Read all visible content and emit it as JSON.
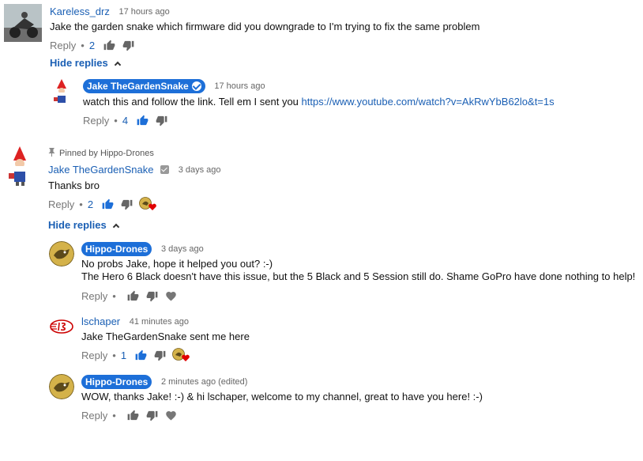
{
  "comments": {
    "c1": {
      "author": "Kareless_drz",
      "time": "17 hours ago",
      "text": "Jake the garden snake which firmware did you downgrade to I'm trying to fix the same problem",
      "reply_label": "Reply",
      "likes": "2"
    },
    "c1_hide": "Hide replies",
    "c2": {
      "author": "Jake TheGardenSnake",
      "time": "17 hours ago",
      "text": "watch this and follow the link. Tell em I sent you ",
      "link": "https://www.youtube.com/watch?v=AkRwYbB62lo&t=1s",
      "reply_label": "Reply",
      "likes": "4"
    },
    "c3": {
      "pinned": "Pinned by Hippo-Drones",
      "author": "Jake TheGardenSnake",
      "time": "3 days ago",
      "text": "Thanks bro",
      "reply_label": "Reply",
      "likes": "2"
    },
    "c3_hide": "Hide replies",
    "c4": {
      "author": "Hippo-Drones",
      "time": "3 days ago",
      "line1": "No probs Jake, hope it helped you out? :-)",
      "line2": "The Hero 6 Black doesn't have this issue, but the 5 Black and 5 Session still do. Shame GoPro have done nothing to help!",
      "reply_label": "Reply"
    },
    "c5": {
      "author": "lschaper",
      "time": "41 minutes ago",
      "text": "Jake TheGardenSnake sent me here",
      "reply_label": "Reply",
      "likes": "1"
    },
    "c6": {
      "author": "Hippo-Drones",
      "time": "2 minutes ago (edited)",
      "text": "WOW, thanks Jake! :-) & hi lschaper, welcome to my channel, great to have you here! :-)",
      "reply_label": "Reply"
    }
  },
  "colors": {
    "link": "#1a5fb4",
    "badge": "#1d6fd8",
    "heart": "#e00000"
  },
  "icons": [
    "thumb-up-icon",
    "thumb-down-icon",
    "heart-icon",
    "pin-icon",
    "verified-icon",
    "chevron-up-icon"
  ]
}
